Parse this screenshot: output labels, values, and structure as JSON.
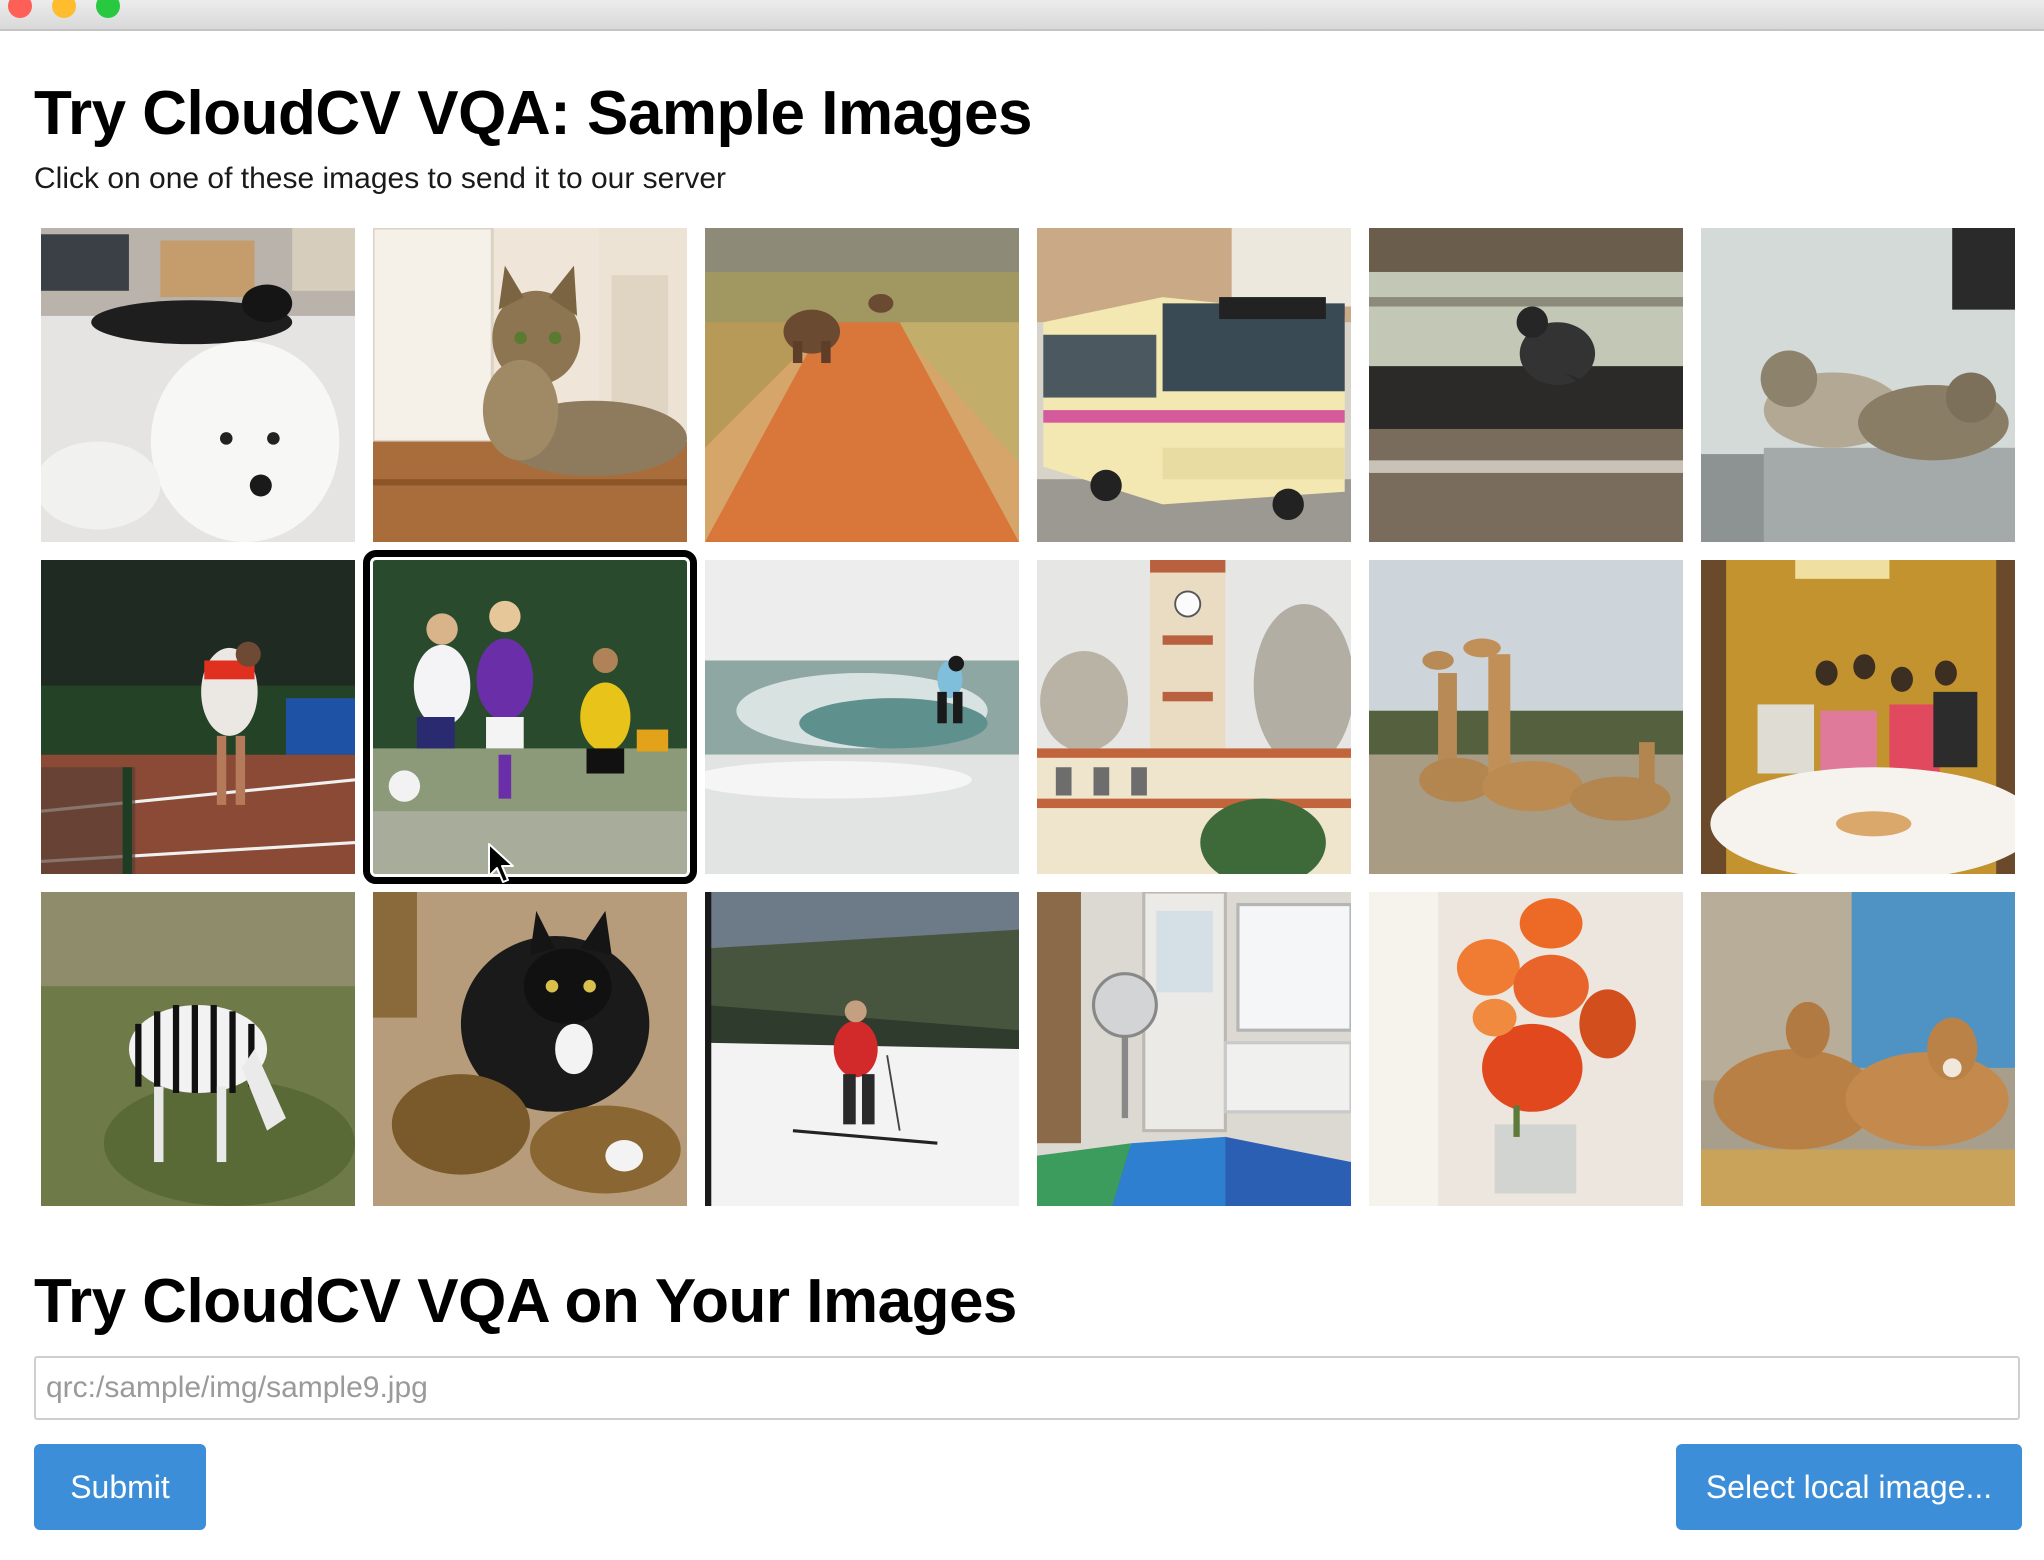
{
  "window": {
    "traffic_lights": [
      "close",
      "minimize",
      "maximize"
    ]
  },
  "sample_section": {
    "title": "Try CloudCV VQA: Sample Images",
    "subtitle": "Click on one of these images to send it to our server",
    "selected_index": 7,
    "images": [
      {
        "name": "dog-and-cat-image"
      },
      {
        "name": "cat-on-floor-image"
      },
      {
        "name": "elephant-road-image"
      },
      {
        "name": "bus-image"
      },
      {
        "name": "crow-on-car-image"
      },
      {
        "name": "cats-on-tv-image"
      },
      {
        "name": "tennis-player-image"
      },
      {
        "name": "soccer-players-image"
      },
      {
        "name": "surfer-image"
      },
      {
        "name": "clock-tower-image"
      },
      {
        "name": "giraffes-image"
      },
      {
        "name": "family-dinner-image"
      },
      {
        "name": "zebra-image"
      },
      {
        "name": "cat-on-shoes-image"
      },
      {
        "name": "skier-image"
      },
      {
        "name": "room-with-fan-image"
      },
      {
        "name": "orange-flowers-image"
      },
      {
        "name": "cows-image"
      }
    ]
  },
  "upload_section": {
    "title": "Try CloudCV VQA on Your Images",
    "input_placeholder": "qrc:/sample/img/sample9.jpg",
    "submit_label": "Submit",
    "select_local_label": "Select local image..."
  },
  "colors": {
    "button_bg": "#3c8ed8",
    "button_text": "#ffffff"
  }
}
